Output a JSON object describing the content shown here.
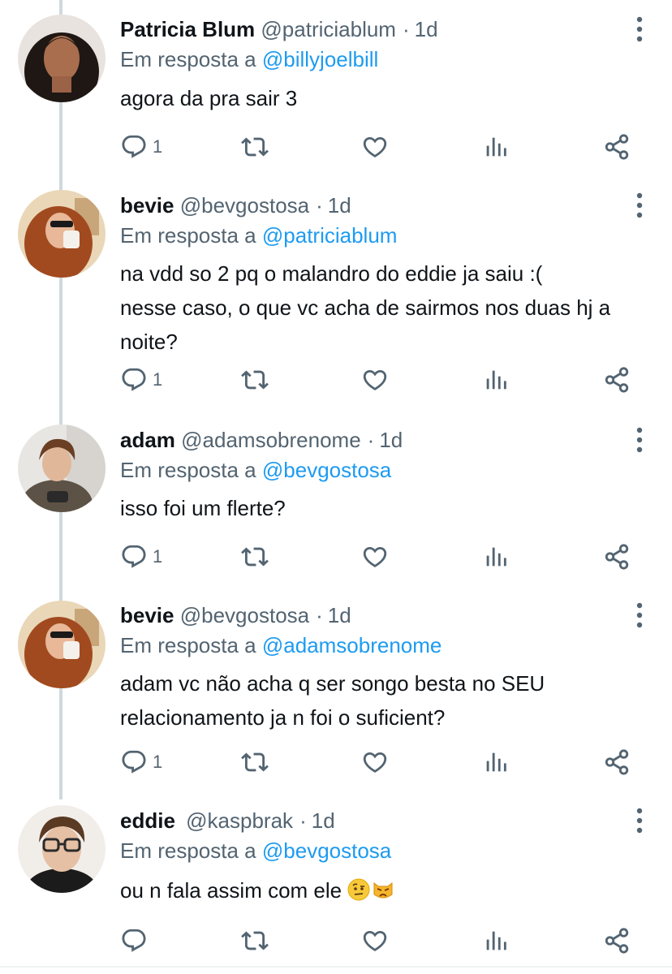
{
  "colors": {
    "text": "#0f1419",
    "secondary": "#536471",
    "link": "#1d9bf0",
    "thread_line": "#cfd9de"
  },
  "reply_prefix": "Em resposta a",
  "tweets": [
    {
      "name": "Patricia Blum",
      "handle": "@patriciablum",
      "time": "1d",
      "reply_to": "@billyjoelbill",
      "text": "agora da pra sair 3",
      "reply_count": "1",
      "icons": [
        "reply-icon",
        "retweet-icon",
        "like-icon",
        "views-icon",
        "share-icon"
      ]
    },
    {
      "name": "bevie",
      "handle": "@bevgostosa",
      "time": "1d",
      "reply_to": "@patriciablum",
      "text_lines": [
        "na vdd so 2 pq o malandro do eddie ja saiu :(",
        "nesse caso, o que vc acha de sairmos nos duas hj a",
        "noite?"
      ],
      "reply_count": "1"
    },
    {
      "name": "adam",
      "handle": "@adamsobrenome",
      "time": "1d",
      "reply_to": "@bevgostosa",
      "text": "isso foi um flerte?",
      "reply_count": "1"
    },
    {
      "name": "bevie",
      "handle": "@bevgostosa",
      "time": "1d",
      "reply_to": "@adamsobrenome",
      "text_lines": [
        "adam vc não acha q ser songo besta no SEU",
        "relacionamento ja n foi o suficient?"
      ],
      "reply_count": "1"
    },
    {
      "name": "eddie",
      "handle": "@kaspbrak",
      "time": "1d",
      "reply_to": "@bevgostosa",
      "text": "ou n fala assim com ele",
      "emojis": [
        "raised-eyebrow-emoji",
        "pouting-cat-emoji"
      ],
      "reply_count": ""
    }
  ]
}
